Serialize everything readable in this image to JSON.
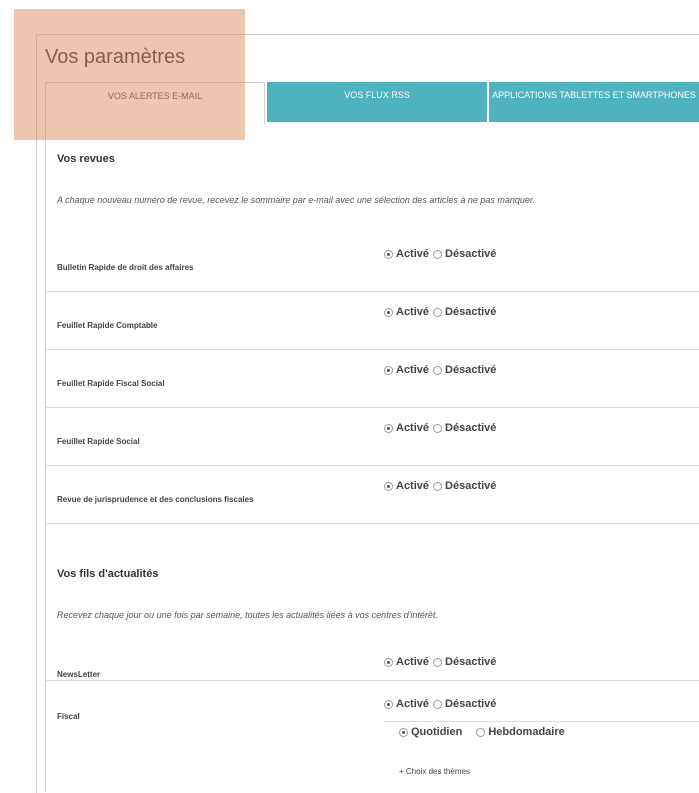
{
  "page": {
    "title": "Vos paramètres"
  },
  "tabs": [
    {
      "label": "VOS ALERTES E-MAIL"
    },
    {
      "label": "VOS FLUX RSS"
    },
    {
      "label": "APPLICATIONS TABLETTES ET SMARTPHONES"
    }
  ],
  "radio_labels": {
    "on": "Activé",
    "off": "Désactivé"
  },
  "revues": {
    "title": "Vos revues",
    "description": "A chaque nouveau numéro de revue, recevez le sommaire par e-mail avec une sélection des articles à ne pas manquer.",
    "items": [
      {
        "label": "Bulletin Rapide de droit des affaires",
        "status": "Activé"
      },
      {
        "label": "Feuillet Rapide Comptable",
        "status": "Activé"
      },
      {
        "label": "Feuillet Rapide Fiscal Social",
        "status": "Activé"
      },
      {
        "label": "Feuillet Rapide Social",
        "status": "Activé"
      },
      {
        "label": "Revue de jurisprudence et des conclusions fiscales",
        "status": "Activé"
      }
    ]
  },
  "actualites": {
    "title": "Vos fils d'actualités",
    "description": "Recevez chaque jour ou une fois par semaine, toutes les actualités liées à vos centres d'intérêt.",
    "items": [
      {
        "label": "NewsLetter",
        "status": "Activé"
      },
      {
        "label": "Fiscal",
        "status": "Activé"
      }
    ],
    "frequency": {
      "daily": "Quotidien",
      "weekly": "Hebdomadaire",
      "selected": "Quotidien"
    },
    "themes_link": "+ Choix des thèmes"
  }
}
